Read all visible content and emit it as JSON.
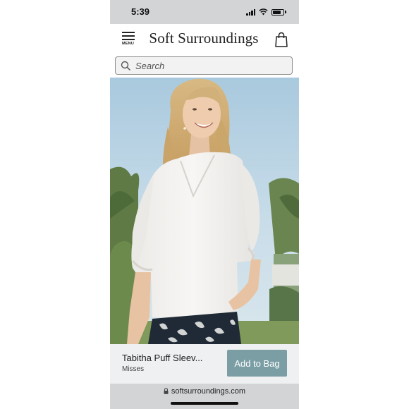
{
  "status_bar": {
    "time": "5:39",
    "icons": [
      "signal-icon",
      "wifi-icon",
      "battery-icon"
    ]
  },
  "header": {
    "menu_label": "MENU",
    "brand": "Soft Surroundings",
    "icons": [
      "hamburger-menu-icon",
      "shopping-bag-icon"
    ]
  },
  "search": {
    "placeholder": "Search"
  },
  "product": {
    "name": "Tabitha Puff Sleev...",
    "subtitle": "Misses",
    "add_to_bag_label": "Add to Bag",
    "button_color": "#7b9ea5"
  },
  "browser": {
    "url": "softsurroundings.com"
  }
}
